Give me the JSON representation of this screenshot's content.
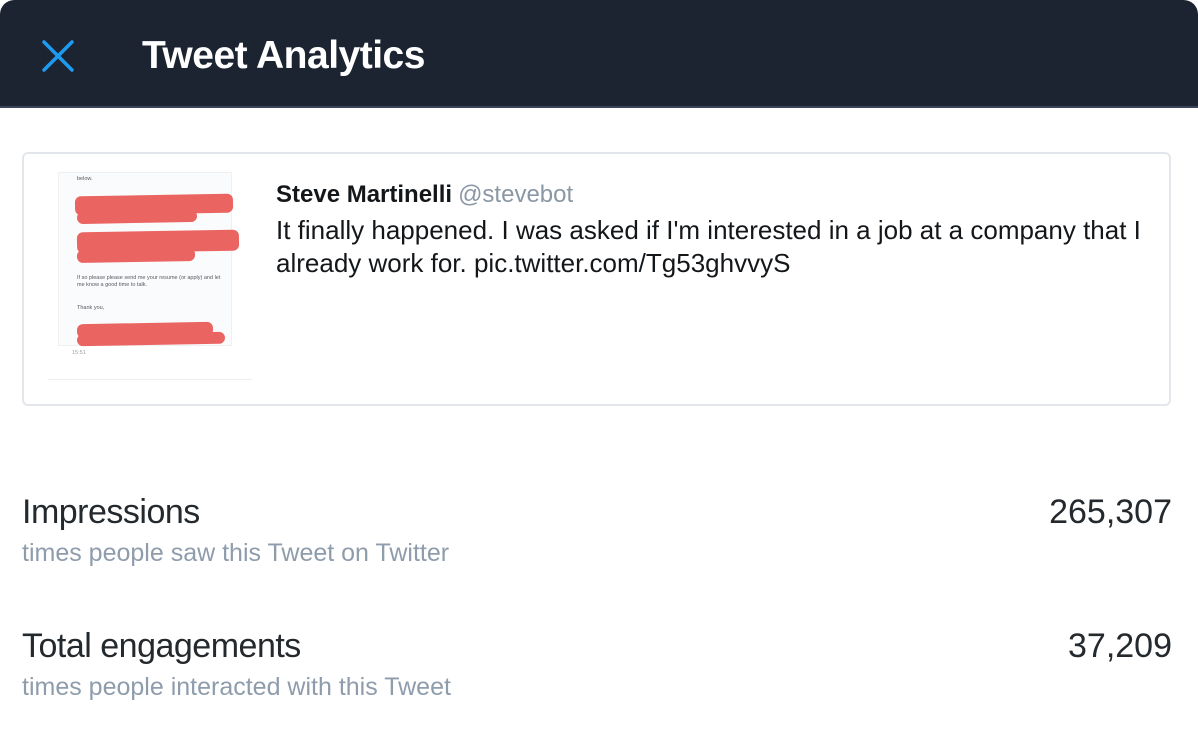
{
  "header": {
    "title": "Tweet Analytics",
    "close_icon": "close-icon"
  },
  "tweet": {
    "author_name": "Steve Martinelli",
    "author_handle": "@stevebot",
    "text": "It finally happened. I was asked if I'm interested in a job at a company that I already work for. pic.twitter.com/Tg53ghvvyS",
    "media": {
      "line_below": "below.",
      "line_request": "If so please please send me your resume (or apply) and let me know a good time to talk.",
      "line_thanks": "Thank you,",
      "line_time": "15:51",
      "redaction_color": "#ea6461"
    }
  },
  "metrics": [
    {
      "label": "Impressions",
      "description": "times people saw this Tweet on Twitter",
      "value": "265,307"
    },
    {
      "label": "Total engagements",
      "description": "times people interacted with this Tweet",
      "value": "37,209"
    }
  ],
  "colors": {
    "header_bg": "#1c2431",
    "close_icon": "#1d9bf0",
    "muted_text": "#8e9cab"
  }
}
